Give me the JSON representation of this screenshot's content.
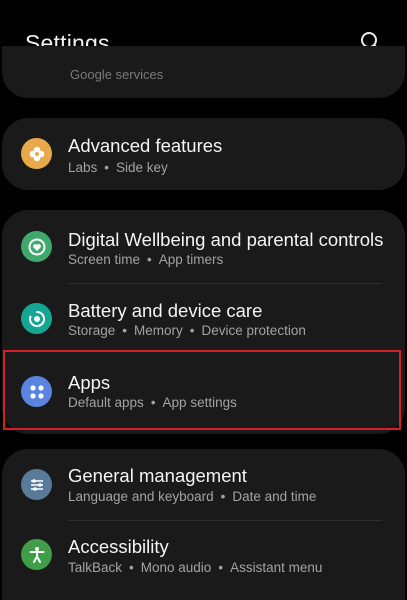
{
  "header": {
    "title": "Settings",
    "search_icon": "search-icon"
  },
  "partial_item": {
    "subtitle": "Google services"
  },
  "items": [
    {
      "title": "Advanced features",
      "sub": [
        "Labs",
        "Side key"
      ],
      "icon": "plus-flower-icon",
      "color": "#e7a94a"
    },
    {
      "title": "Digital Wellbeing and parental controls",
      "sub": [
        "Screen time",
        "App timers"
      ],
      "icon": "heart-ring-icon",
      "color": "#3fa86d"
    },
    {
      "title": "Battery and device care",
      "sub": [
        "Storage",
        "Memory",
        "Device protection"
      ],
      "icon": "device-care-icon",
      "color": "#16a592"
    },
    {
      "title": "Apps",
      "sub": [
        "Default apps",
        "App settings"
      ],
      "icon": "apps-grid-icon",
      "color": "#5b84e0"
    },
    {
      "title": "General management",
      "sub": [
        "Language and keyboard",
        "Date and time"
      ],
      "icon": "sliders-icon",
      "color": "#5a7a99"
    },
    {
      "title": "Accessibility",
      "sub": [
        "TalkBack",
        "Mono audio",
        "Assistant menu"
      ],
      "icon": "accessibility-icon",
      "color": "#3f9e47"
    }
  ],
  "colors": {
    "highlight": "#d1202a",
    "card": "#1a1a1a",
    "background": "#000000"
  }
}
